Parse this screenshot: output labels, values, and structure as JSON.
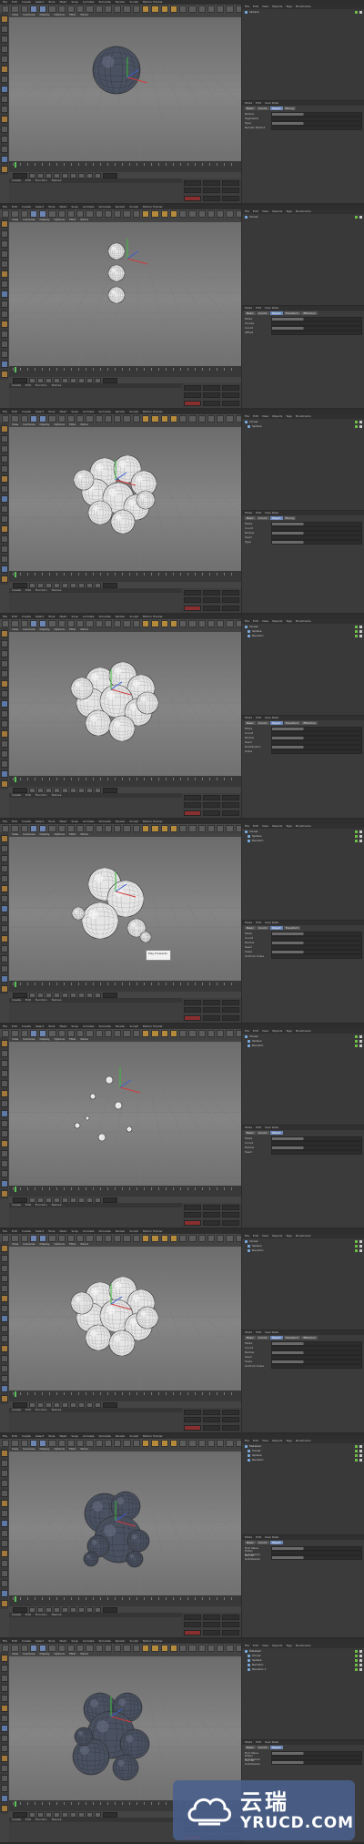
{
  "app": {
    "menu": [
      "File",
      "Edit",
      "Create",
      "Select",
      "Tools",
      "Mesh",
      "Snap",
      "Animate",
      "Simulate",
      "Render",
      "Sculpt",
      "Motion Tracker",
      "MoGraph",
      "Character",
      "Pipeline",
      "Plugins",
      "Script",
      "Window",
      "Help"
    ],
    "viewport_menu": [
      "View",
      "Cameras",
      "Display",
      "Options",
      "Filter",
      "Panel"
    ],
    "material_menu": [
      "Create",
      "Edit",
      "Function",
      "Texture"
    ],
    "object_menu": [
      "File",
      "Edit",
      "View",
      "Objects",
      "Tags",
      "Bookmarks"
    ],
    "attribute_menu": [
      "Mode",
      "Edit",
      "User Data"
    ]
  },
  "panels": [
    {
      "tabs": [
        "Basic",
        "Coord.",
        "Object",
        "Phong"
      ],
      "objects": [
        "Sphere"
      ],
      "attributes": [
        "Radius",
        "Segments",
        "Type",
        "Render Perfect"
      ],
      "scene": {
        "type": "single-sphere",
        "shade": "dark"
      },
      "tooltip": null
    },
    {
      "tabs": [
        "Basic",
        "Coord.",
        "Object",
        "Transform",
        "Effectors"
      ],
      "objects": [
        "Cloner"
      ],
      "attributes": [
        "Mode",
        "Clones",
        "Count",
        "Offset"
      ],
      "scene": {
        "type": "column",
        "shade": "white"
      },
      "tooltip": null
    },
    {
      "tabs": [
        "Basic",
        "Coord.",
        "Object",
        "Phong"
      ],
      "objects": [
        "Cloner",
        "Sphere"
      ],
      "attributes": [
        "Mode",
        "Count",
        "Radius",
        "Seed",
        "Type"
      ],
      "scene": {
        "type": "cluster-open",
        "shade": "white"
      },
      "tooltip": null
    },
    {
      "tabs": [
        "Basic",
        "Coord.",
        "Object",
        "Transform",
        "Effectors"
      ],
      "objects": [
        "Cloner",
        "Sphere",
        "Random"
      ],
      "attributes": [
        "Mode",
        "Count",
        "Radius",
        "Seed",
        "Distribution",
        "Scale"
      ],
      "scene": {
        "type": "cluster",
        "shade": "white"
      },
      "tooltip": null
    },
    {
      "tabs": [
        "Basic",
        "Coord.",
        "Object",
        "Transform"
      ],
      "objects": [
        "Cloner",
        "Sphere",
        "Random"
      ],
      "attributes": [
        "Mode",
        "Count",
        "Radius",
        "Seed",
        "Scale",
        "Uniform Scale"
      ],
      "scene": {
        "type": "blob",
        "shade": "white"
      },
      "tooltip": "Play Forwards"
    },
    {
      "tabs": [
        "Basic",
        "Coord.",
        "Object"
      ],
      "objects": [
        "Cloner",
        "Sphere",
        "Random"
      ],
      "attributes": [
        "Mode",
        "Count",
        "Radius",
        "Seed"
      ],
      "scene": {
        "type": "scatter",
        "shade": "white"
      },
      "tooltip": null
    },
    {
      "tabs": [
        "Basic",
        "Coord.",
        "Object",
        "Transform",
        "Effectors"
      ],
      "objects": [
        "Cloner",
        "Sphere",
        "Random"
      ],
      "attributes": [
        "Mode",
        "Count",
        "Radius",
        "Seed",
        "Scale",
        "Uniform Scale"
      ],
      "scene": {
        "type": "cluster",
        "shade": "white"
      },
      "tooltip": null
    },
    {
      "tabs": [
        "Basic",
        "Coord.",
        "Object"
      ],
      "objects": [
        "Metaball",
        "Cloner",
        "Sphere",
        "Random"
      ],
      "attributes": [
        "Hull Value",
        "Editor Subdivision",
        "Render Subdivision"
      ],
      "scene": {
        "type": "metaball",
        "shade": "dark"
      },
      "tooltip": null
    },
    {
      "tabs": [
        "Basic",
        "Coord.",
        "Object"
      ],
      "objects": [
        "Metaball",
        "Cloner",
        "Sphere",
        "Random",
        "Random.1"
      ],
      "attributes": [
        "Hull Value",
        "Editor Subdivision",
        "Render Subdivision"
      ],
      "scene": {
        "type": "metaball-big",
        "shade": "dark"
      },
      "tooltip": null
    }
  ],
  "watermark": {
    "cn": "云瑞",
    "en": "YRUCD.COM"
  },
  "colors": {
    "accent": "#6c85b3",
    "sphere_white": "#e6e6e6",
    "sphere_dark": "#4a5160",
    "axis_x": "#d23c3c",
    "axis_y": "#3cbd3c",
    "axis_z": "#3c5fd2"
  }
}
